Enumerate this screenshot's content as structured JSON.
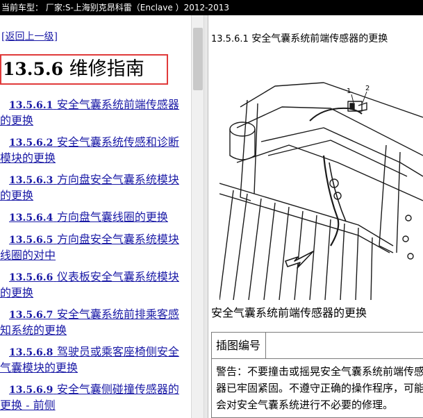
{
  "title_bar": "当前车型：  厂家:S-上海别克昂科雷（Enclave ）2012-2013",
  "left": {
    "back_link": "[返回上一级]",
    "section_number": "13.5.6",
    "section_title": "维修指南",
    "toc": [
      {
        "num": "13.5.6.1",
        "text": "安全气囊系统前端传感器的更换"
      },
      {
        "num": "13.5.6.2",
        "text": "安全气囊系统传感和诊断模块的更换"
      },
      {
        "num": "13.5.6.3",
        "text": "方向盘安全气囊系统模块的更换"
      },
      {
        "num": "13.5.6.4",
        "text": "方向盘气囊线圈的更换"
      },
      {
        "num": "13.5.6.5",
        "text": "方向盘安全气囊系统模块线圈的对中"
      },
      {
        "num": "13.5.6.6",
        "text": "仪表板安全气囊系统模块的更换"
      },
      {
        "num": "13.5.6.7",
        "text": "安全气囊系统前排乘客感知系统的更换"
      },
      {
        "num": "13.5.6.8",
        "text": "驾驶员或乘客座椅侧安全气囊模块的更换"
      },
      {
        "num": "13.5.6.9",
        "text": "安全气囊侧碰撞传感器的更换 - 前侧"
      }
    ]
  },
  "right": {
    "heading_number": "13.5.6.1",
    "heading_text": "安全气囊系统前端传感器的更换",
    "callout_1": "1",
    "callout_2": "2",
    "caption": "安全气囊系统前端传感器的更换",
    "table_header": "插图编号",
    "warning": "警告：不要撞击或摇晃安全气囊系统前端传感器已牢固紧固。不遵守正确的操作程序，可能会对安全气囊系统进行不必要的修理。"
  },
  "colors": {
    "titlebar_bg": "#000000",
    "link": "#1a1aa6",
    "highlight_border": "#e03a3a"
  }
}
